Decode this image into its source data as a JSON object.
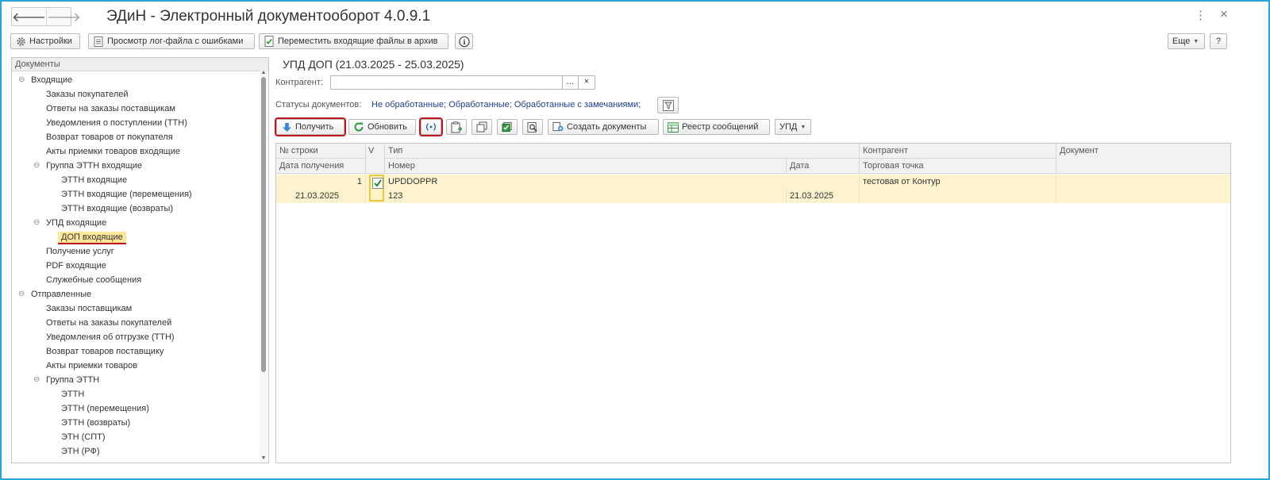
{
  "window": {
    "title": "ЭДиН - Электронный документооборот 4.0.9.1",
    "menu_glyph": "⋮",
    "close_glyph": "×",
    "back_glyph": "🡐",
    "forward_glyph": "🡒"
  },
  "toolbar": {
    "settings": "Настройки",
    "view_log": "Просмотр лог-файла с ошибками",
    "move_archive": "Переместить входящие файлы в архив",
    "info_glyph": "i",
    "more": "Еще",
    "help": "?"
  },
  "sidebar": {
    "header": "Документы",
    "items": [
      {
        "label": "Входящие"
      },
      {
        "label": "Заказы покупателей"
      },
      {
        "label": "Ответы на заказы поставщикам"
      },
      {
        "label": "Уведомления о поступлении (ТТН)"
      },
      {
        "label": "Возврат товаров от покупателя"
      },
      {
        "label": "Акты приемки товаров входящие"
      },
      {
        "label": "Группа ЭТТН входящие"
      },
      {
        "label": "ЭТТН входящие"
      },
      {
        "label": "ЭТТН входящие (перемещения)"
      },
      {
        "label": "ЭТТН входящие (возвраты)"
      },
      {
        "label": "УПД входящие"
      },
      {
        "label": "ДОП входящие"
      },
      {
        "label": "Получение услуг"
      },
      {
        "label": "PDF входящие"
      },
      {
        "label": "Служебные сообщения"
      },
      {
        "label": "Отправленные"
      },
      {
        "label": "Заказы поставщикам"
      },
      {
        "label": "Ответы на заказы покупателей"
      },
      {
        "label": "Уведомления об отгрузке (ТТН)"
      },
      {
        "label": "Возврат товаров поставщику"
      },
      {
        "label": "Акты приемки товаров"
      },
      {
        "label": "Группа ЭТТН"
      },
      {
        "label": "ЭТТН"
      },
      {
        "label": "ЭТТН (перемещения)"
      },
      {
        "label": "ЭТТН (возвраты)"
      },
      {
        "label": "ЭТН (СПТ)"
      },
      {
        "label": "ЭТН (РФ)"
      }
    ]
  },
  "main": {
    "title": "УПД ДОП (21.03.2025 - 25.03.2025)",
    "counterparty_label": "Контрагент:",
    "counterparty_value": "",
    "select_glyph": "...",
    "clear_glyph": "×",
    "statuses_label": "Статусы документов:",
    "statuses_value": "Не обработанные; Обработанные; Обработанные с замечаниями;"
  },
  "actions": {
    "receive": "Получить",
    "refresh": "Обновить",
    "create_docs": "Создать документы",
    "registry": "Реестр сообщений",
    "upd": "УПД"
  },
  "grid": {
    "columns_top": [
      "№ строки",
      "V",
      "Тип",
      "Контрагент",
      "Документ"
    ],
    "columns_bottom": [
      "Дата получения",
      "Номер",
      "Дата",
      "Торговая точка"
    ],
    "rows": [
      {
        "line_no": "1",
        "checked": true,
        "type": "UPDDOPPR",
        "counterparty": "тестовая от Контур",
        "document": "",
        "received_date": "21.03.2025",
        "number": "123",
        "date": "21.03.2025",
        "trade_point": ""
      }
    ]
  },
  "colors": {
    "frame": "#2aa3da",
    "selected_row": "#fdf4cf",
    "highlight": "#c0161f",
    "link": "#1c3f94"
  }
}
